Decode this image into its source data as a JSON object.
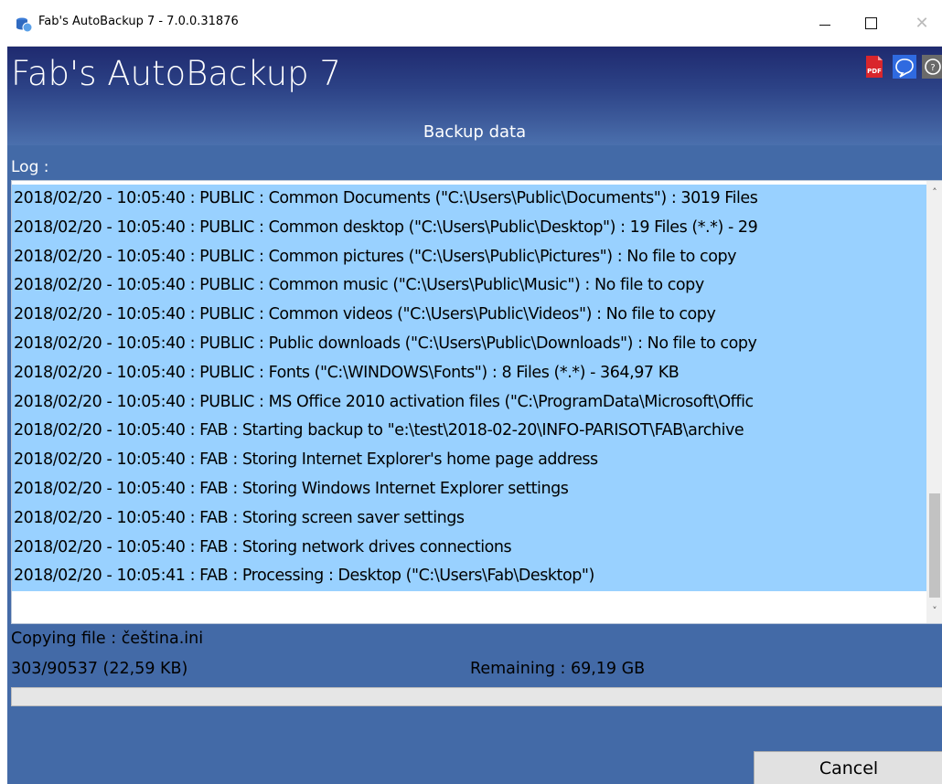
{
  "window": {
    "title": "Fab's AutoBackup 7 - 7.0.0.31876"
  },
  "header": {
    "app_title": "Fab's AutoBackup 7",
    "icons": [
      "pdf-icon",
      "help-bubble-icon",
      "about-icon"
    ],
    "pdf_text": "PDF"
  },
  "main": {
    "section_title": "Backup data",
    "log_label": "Log :",
    "log_lines": [
      "2018/02/20 - 10:05:40 : PUBLIC : Common Documents (\"C:\\Users\\Public\\Documents\") : 3019 Files",
      "2018/02/20 - 10:05:40 : PUBLIC : Common desktop (\"C:\\Users\\Public\\Desktop\") : 19 Files (*.*) - 29",
      "2018/02/20 - 10:05:40 : PUBLIC : Common pictures (\"C:\\Users\\Public\\Pictures\") : No file to copy",
      "2018/02/20 - 10:05:40 : PUBLIC : Common music (\"C:\\Users\\Public\\Music\") : No file to copy",
      "2018/02/20 - 10:05:40 : PUBLIC : Common videos (\"C:\\Users\\Public\\Videos\") : No file to copy",
      "2018/02/20 - 10:05:40 : PUBLIC : Public downloads (\"C:\\Users\\Public\\Downloads\") : No file to copy",
      "2018/02/20 - 10:05:40 : PUBLIC : Fonts (\"C:\\WINDOWS\\Fonts\") : 8 Files (*.*) - 364,97 KB",
      "2018/02/20 - 10:05:40 : PUBLIC : MS Office 2010 activation files (\"C:\\ProgramData\\Microsoft\\Offic",
      "2018/02/20 - 10:05:40 : FAB : Starting backup to \"e:\\test\\2018-02-20\\INFO-PARISOT\\FAB\\archive",
      "2018/02/20 - 10:05:40 : FAB : Storing Internet Explorer's home page address",
      "2018/02/20 - 10:05:40 : FAB : Storing Windows Internet Explorer settings",
      "2018/02/20 - 10:05:40 : FAB : Storing screen saver settings",
      "2018/02/20 - 10:05:40 : FAB : Storing network drives connections",
      "2018/02/20 - 10:05:41 : FAB : Processing : Desktop (\"C:\\Users\\Fab\\Desktop\")"
    ],
    "copying_text": "Copying file : čeština.ini",
    "count_text": "303/90537 (22,59 KB)",
    "remaining_text": "Remaining : 69,19 GB",
    "progress_fraction": 0.0,
    "cancel_label": "Cancel"
  },
  "colors": {
    "header_dark": "#1f2a6f",
    "panel_blue": "#436aa7",
    "log_highlight": "#99d1ff"
  }
}
